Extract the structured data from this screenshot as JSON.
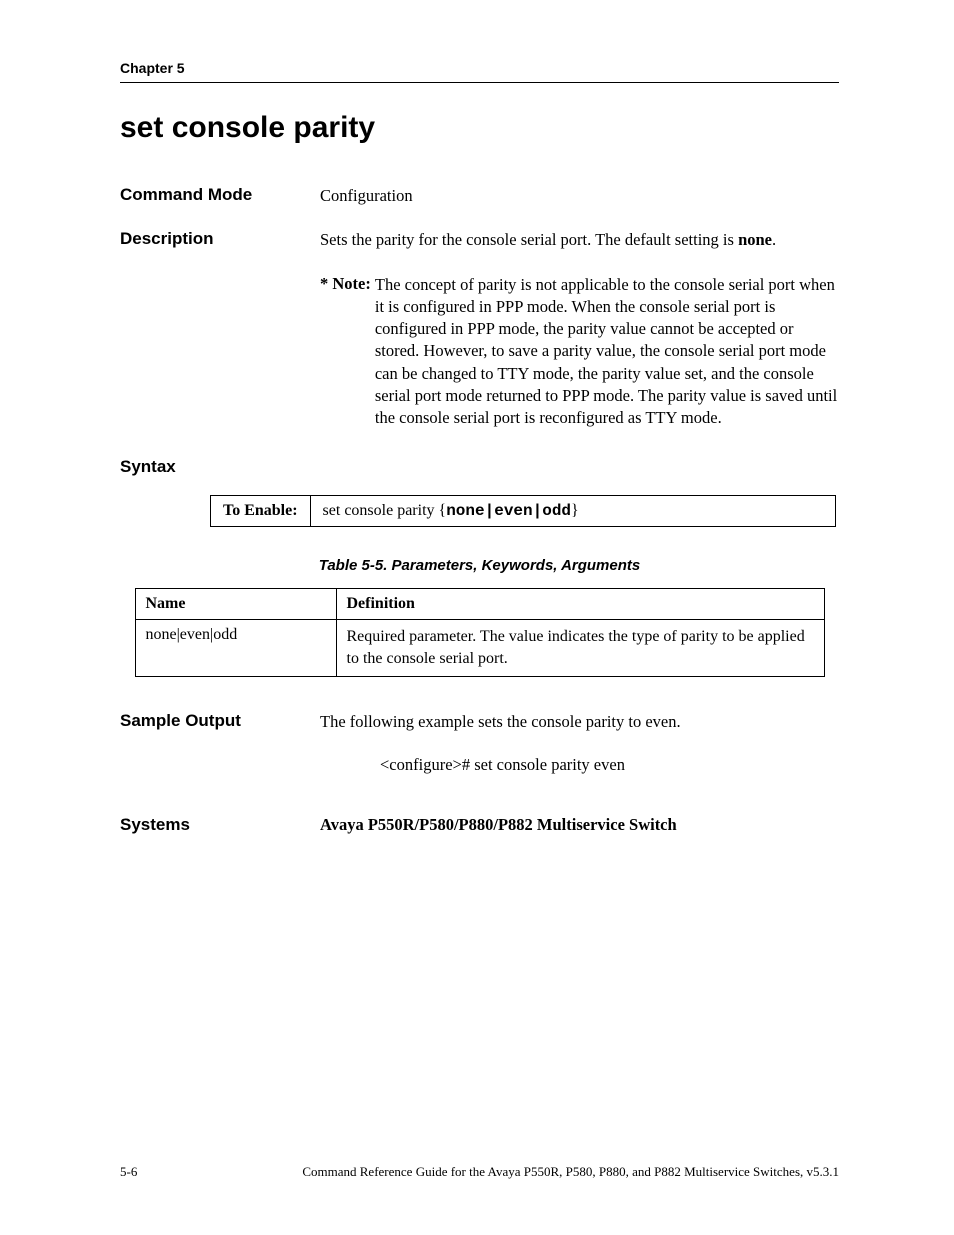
{
  "header": {
    "chapter": "Chapter 5"
  },
  "title": "set console parity",
  "command_mode": {
    "label": "Command Mode",
    "value": "Configuration"
  },
  "description": {
    "label": "Description",
    "text_a": "Sets the parity for the console serial port. The default setting is ",
    "text_b": "none",
    "text_c": "."
  },
  "note": {
    "label": "* Note:",
    "text": "The concept of parity is not applicable to the console serial port when it is configured in PPP mode. When the console serial port is configured in PPP mode, the parity value cannot be accepted or stored. However, to save a parity value, the console serial port mode can be changed to TTY mode, the parity value set, and the console serial port mode returned to PPP mode. The parity value is saved until the console serial port is reconfigured as TTY mode."
  },
  "syntax": {
    "label": "Syntax",
    "row_label": "To Enable:",
    "cmd_a": "set console parity {",
    "cmd_b": "none|even|odd",
    "cmd_c": "}"
  },
  "param_table": {
    "caption": "Table 5-5.  Parameters, Keywords, Arguments",
    "h1": "Name",
    "h2": "Definition",
    "r1c1": "none|even|odd",
    "r1c2": "Required parameter. The value indicates the type of parity to be applied to the console serial port."
  },
  "sample": {
    "label": "Sample Output",
    "text": "The following example sets the console parity to even.",
    "cmd_a": "<configure># ",
    "cmd_b": "set console parity even"
  },
  "systems": {
    "label": "Systems",
    "value": "Avaya P550R/P580/P880/P882 Multiservice Switch"
  },
  "footer": {
    "page": "5-6",
    "text": "Command Reference Guide for the Avaya P550R, P580, P880, and P882 Multiservice Switches, v5.3.1"
  }
}
